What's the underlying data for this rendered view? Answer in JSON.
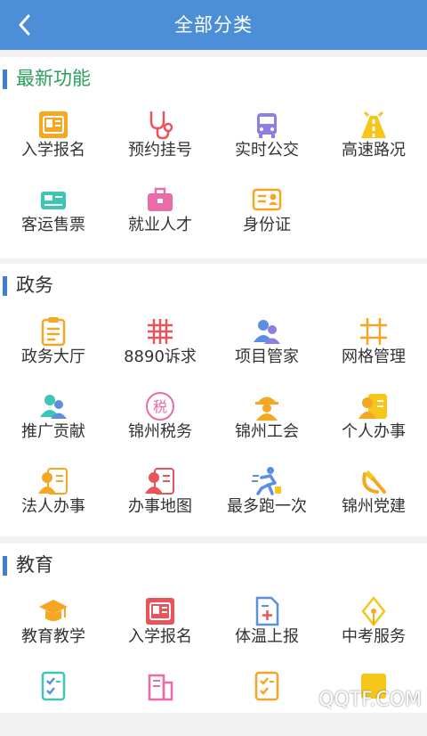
{
  "header": {
    "title": "全部分类",
    "back_icon": "chevron-left-icon"
  },
  "sections": [
    {
      "title": "最新功能",
      "title_color": "#2aa05c",
      "items": [
        {
          "label": "入学报名",
          "icon": "id-card-icon"
        },
        {
          "label": "预约挂号",
          "icon": "stethoscope-icon"
        },
        {
          "label": "实时公交",
          "icon": "bus-icon"
        },
        {
          "label": "高速路况",
          "icon": "highway-icon"
        },
        {
          "label": "客运售票",
          "icon": "ticket-icon"
        },
        {
          "label": "就业人才",
          "icon": "briefcase-icon"
        },
        {
          "label": "身份证",
          "icon": "identity-card-icon"
        }
      ]
    },
    {
      "title": "政务",
      "title_color": "#333333",
      "items": [
        {
          "label": "政务大厅",
          "icon": "clipboard-icon"
        },
        {
          "label": "8890诉求",
          "icon": "grid-hash-icon"
        },
        {
          "label": "项目管家",
          "icon": "people-icon"
        },
        {
          "label": "网格管理",
          "icon": "frame-grid-icon"
        },
        {
          "label": "推广贡献",
          "icon": "people-icon"
        },
        {
          "label": "锦州税务",
          "icon": "tax-icon",
          "icon_text": "税"
        },
        {
          "label": "锦州工会",
          "icon": "worker-icon"
        },
        {
          "label": "个人办事",
          "icon": "person-card-icon"
        },
        {
          "label": "法人办事",
          "icon": "person-card-icon"
        },
        {
          "label": "办事地图",
          "icon": "person-card-icon"
        },
        {
          "label": "最多跑一次",
          "icon": "runner-icon"
        },
        {
          "label": "锦州党建",
          "icon": "hammer-sickle-icon"
        }
      ]
    },
    {
      "title": "教育",
      "title_color": "#333333",
      "items": [
        {
          "label": "教育教学",
          "icon": "graduation-cap-icon"
        },
        {
          "label": "入学报名",
          "icon": "id-card-icon"
        },
        {
          "label": "体温上报",
          "icon": "document-plus-icon"
        },
        {
          "label": "中考服务",
          "icon": "pen-nib-icon"
        },
        {
          "label": "",
          "icon": "checklist-icon"
        },
        {
          "label": "",
          "icon": "building-icon"
        },
        {
          "label": "",
          "icon": "checklist-icon"
        },
        {
          "label": "",
          "icon": "yellow-box-icon"
        }
      ]
    }
  ],
  "colors": {
    "header_bg": "#4d8fd6",
    "section_bar": "#3f7ed3",
    "orange": "#f5a623",
    "red": "#e8545a",
    "blue": "#5b8fe0",
    "teal": "#3ec6b5",
    "purple": "#8b7fe6",
    "pink": "#e96ba8",
    "yellow": "#f6c61b"
  },
  "watermark": "QQTF.COM"
}
